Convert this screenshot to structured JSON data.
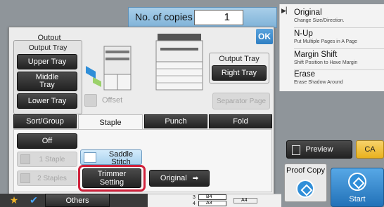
{
  "copies": {
    "label": "No. of copies",
    "value": "1"
  },
  "functions": [
    {
      "title": "Original",
      "desc": "Change Size/Direction."
    },
    {
      "title": "N-Up",
      "desc": "Put Multiple Pages in A Page"
    },
    {
      "title": "Margin Shift",
      "desc": "Shift Position to Have Margin"
    },
    {
      "title": "Erase",
      "desc": "Erase Shadow Around"
    }
  ],
  "dialog": {
    "ok_label": "OK",
    "output_label": "Output",
    "output_tray_label": "Output Tray",
    "trays": [
      "Upper Tray",
      "Middle Tray",
      "Lower Tray"
    ],
    "offset_label": "Offset",
    "right_output_tray_label": "Output Tray",
    "right_tray_button": "Right Tray",
    "separator_page": "Separator Page",
    "tabs": [
      "Sort/Group",
      "Staple",
      "Punch",
      "Fold"
    ],
    "active_tab": "Staple",
    "staple": {
      "off": "Off",
      "one_staple": "1 Staple",
      "two_staples": "2 Staples",
      "saddle_stitch": "Saddle Stitch",
      "trimmer_setting": "Trimmer Setting",
      "original": "Original"
    }
  },
  "preview_label": "Preview",
  "ca_label": "CA",
  "proof_copy_label": "Proof Copy",
  "start_label": "Start",
  "others_label": "Others",
  "paper": {
    "rows": [
      {
        "num": "3",
        "size": "B4"
      },
      {
        "num": "4",
        "size": "A3"
      }
    ],
    "extra": "A4"
  },
  "colors": {
    "accent_blue": "#2f8ed8",
    "highlight_red": "#d0213b",
    "ca_yellow": "#e9b21e"
  }
}
